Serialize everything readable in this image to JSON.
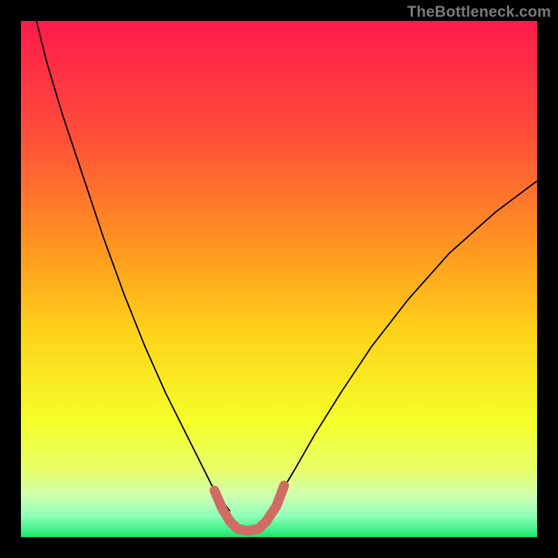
{
  "watermark": "TheBottleneck.com",
  "chart_data": {
    "type": "line",
    "title": "",
    "xlabel": "",
    "ylabel": "",
    "xlim": [
      0,
      100
    ],
    "ylim": [
      0,
      100
    ],
    "grid": false,
    "legend": false,
    "gradient_stops": [
      {
        "offset": 0,
        "color": "#ff1a4b"
      },
      {
        "offset": 0.22,
        "color": "#ff4e3a"
      },
      {
        "offset": 0.45,
        "color": "#ff9a1f"
      },
      {
        "offset": 0.6,
        "color": "#ffd21a"
      },
      {
        "offset": 0.78,
        "color": "#f4ff2a"
      },
      {
        "offset": 0.87,
        "color": "#e8ff6a"
      },
      {
        "offset": 0.92,
        "color": "#cfffb0"
      },
      {
        "offset": 0.96,
        "color": "#8dffb8"
      },
      {
        "offset": 1.0,
        "color": "#17e86e"
      }
    ],
    "series": [
      {
        "name": "left-curve",
        "color": "#000000",
        "width": 2,
        "x": [
          3,
          5,
          8,
          12,
          16,
          20,
          24,
          28,
          32,
          35,
          37,
          39,
          40.5
        ],
        "y": [
          100,
          92,
          82,
          70,
          58,
          47,
          37,
          28,
          20,
          14,
          10,
          7,
          5
        ]
      },
      {
        "name": "right-curve",
        "color": "#000000",
        "width": 2,
        "x": [
          48,
          50,
          53,
          57,
          62,
          68,
          75,
          83,
          92,
          100
        ],
        "y": [
          5,
          8,
          13,
          20,
          28,
          37,
          46,
          55,
          63,
          69
        ]
      },
      {
        "name": "bottom-notch",
        "color": "#cf6d64",
        "width": 14,
        "linecap": "round",
        "x": [
          37.5,
          39,
          40.5,
          42,
          44,
          46,
          47.5,
          49.5,
          51
        ],
        "y": [
          9,
          5.5,
          3,
          1.6,
          1.2,
          1.6,
          3,
          6,
          10
        ]
      }
    ]
  }
}
